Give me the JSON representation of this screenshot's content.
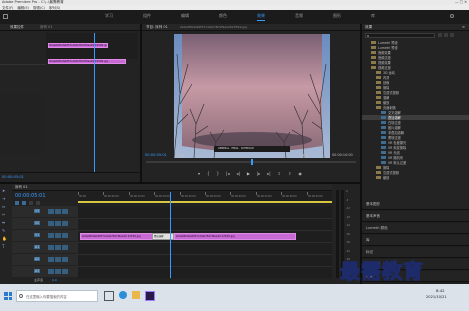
{
  "window": {
    "title": "Adobe Premiere Pro - C:\\..\\最需教育"
  },
  "menu": [
    {
      "label": "文件(F)"
    },
    {
      "label": "编辑(E)"
    },
    {
      "label": "剪辑(C)"
    },
    {
      "label": "序列(S)"
    }
  ],
  "workspaces": [
    {
      "label": "学习"
    },
    {
      "label": "组件"
    },
    {
      "label": "编辑"
    },
    {
      "label": "颜色"
    },
    {
      "label": "效果"
    },
    {
      "label": "音频"
    },
    {
      "label": "图形"
    },
    {
      "label": "库"
    }
  ],
  "active_workspace": "效果",
  "source_panel": {
    "tab": "效果控件",
    "subtitle": "序列 01",
    "clips": [
      {
        "label": "Slide06f2efe6f57xdafe78d1f9ae26 22599.jpg"
      },
      {
        "label": "Slide06f2efe6f57xdafe78d1f9ae26 22599.jpg"
      }
    ],
    "timecode": "00:00:05:01"
  },
  "program_monitor": {
    "tab": "节目: 序列 01",
    "subtitle": "slide06f2efe6f57xdafe78d1f9ae2622599.jpg",
    "image_caption": "GENERAL · EMAIL · SCHEDULE",
    "timecode_left": "00:00:05:01",
    "fit_label": "适合",
    "quality_label": "完整",
    "timecode_right": "00:00:10:00"
  },
  "effects_panel": {
    "title": "效果",
    "search_placeholder": "",
    "items": [
      {
        "label": "Lumetri 预设",
        "type": "folder",
        "indent": 1
      },
      {
        "label": "Lumetri 预设",
        "type": "folder",
        "indent": 1
      },
      {
        "label": "音频效果",
        "type": "folder",
        "indent": 1
      },
      {
        "label": "音频过渡",
        "type": "folder",
        "indent": 1
      },
      {
        "label": "视频效果",
        "type": "folder",
        "indent": 1
      },
      {
        "label": "视频过渡",
        "type": "folder",
        "indent": 1
      },
      {
        "label": "3D 运动",
        "type": "folder",
        "indent": 2
      },
      {
        "label": "内滑",
        "type": "folder",
        "indent": 2
      },
      {
        "label": "划像",
        "type": "folder",
        "indent": 2
      },
      {
        "label": "擦除",
        "type": "folder",
        "indent": 2
      },
      {
        "label": "沉浸式视频",
        "type": "folder",
        "indent": 2
      },
      {
        "label": "溶解",
        "type": "folder",
        "indent": 2
      },
      {
        "label": "缩放",
        "type": "folder",
        "indent": 2
      },
      {
        "label": "页面剥落",
        "type": "folder",
        "indent": 2
      },
      {
        "label": "交叉溶解",
        "type": "fx",
        "indent": 3
      },
      {
        "label": "叠加溶解",
        "type": "fx",
        "indent": 3,
        "selected": true
      },
      {
        "label": "白场过渡",
        "type": "fx",
        "indent": 3
      },
      {
        "label": "胶片溶解",
        "type": "fx",
        "indent": 3
      },
      {
        "label": "非叠加溶解",
        "type": "fx",
        "indent": 3
      },
      {
        "label": "黑场过渡",
        "type": "fx",
        "indent": 3
      },
      {
        "label": "VR 色度漏光",
        "type": "fx",
        "indent": 3
      },
      {
        "label": "VR 渐变擦除",
        "type": "fx",
        "indent": 3
      },
      {
        "label": "VR 光线",
        "type": "fx",
        "indent": 3
      },
      {
        "label": "VR 随机块",
        "type": "fx",
        "indent": 3
      },
      {
        "label": "VR 默认过渡",
        "type": "fx",
        "indent": 3
      },
      {
        "label": "擦除",
        "type": "folder",
        "indent": 2
      },
      {
        "label": "沉浸式视频",
        "type": "folder",
        "indent": 2
      },
      {
        "label": "缩放",
        "type": "folder",
        "indent": 2
      }
    ],
    "sub_panels": [
      {
        "label": "基本图形"
      },
      {
        "label": "基本声音"
      },
      {
        "label": "Lumetri 颜色"
      },
      {
        "label": "库"
      },
      {
        "label": "标记"
      },
      {
        "label": "历史记录"
      },
      {
        "label": "信息"
      }
    ]
  },
  "timeline": {
    "tab": "序列 01",
    "timecode": "00:00:05:01",
    "ruler": [
      "00:00",
      "00:00:05:00",
      "00:00:10:00",
      "00:00:15:00",
      "00:00:20:00",
      "00:00:25:00",
      "00:00:30:00",
      "00:00:35:00",
      "00:00:40:00",
      "00:00:45:00"
    ],
    "tracks": [
      {
        "name": "V3"
      },
      {
        "name": "V2"
      },
      {
        "name": "V1"
      },
      {
        "name": "A1"
      },
      {
        "name": "A2"
      },
      {
        "name": "A3"
      }
    ],
    "master_label": "主声道",
    "master_value": "0.0",
    "clips": [
      {
        "label": "slide06f2efe6f57xdafe78d1f9ae26 22599.jpg"
      },
      {
        "label": "叠加溶解"
      },
      {
        "label": "slide06f2efe6f57xdafe78d1f9ae26 22599.jpg"
      }
    ]
  },
  "meters": [
    "0",
    "-6",
    "-12",
    "-18",
    "-24",
    "-30",
    "-36",
    "-42",
    "-48",
    "-54"
  ],
  "watermark": {
    "text": "最需教育"
  },
  "taskbar": {
    "search_placeholder": "在这里输入你要搜索的内容",
    "time": "8:42",
    "date": "2021/10/21"
  },
  "colors": {
    "accent": "#2d8ceb",
    "clip": "#c86ad4",
    "playhead": "#3a9bff",
    "bg": "#1d1d1d"
  }
}
